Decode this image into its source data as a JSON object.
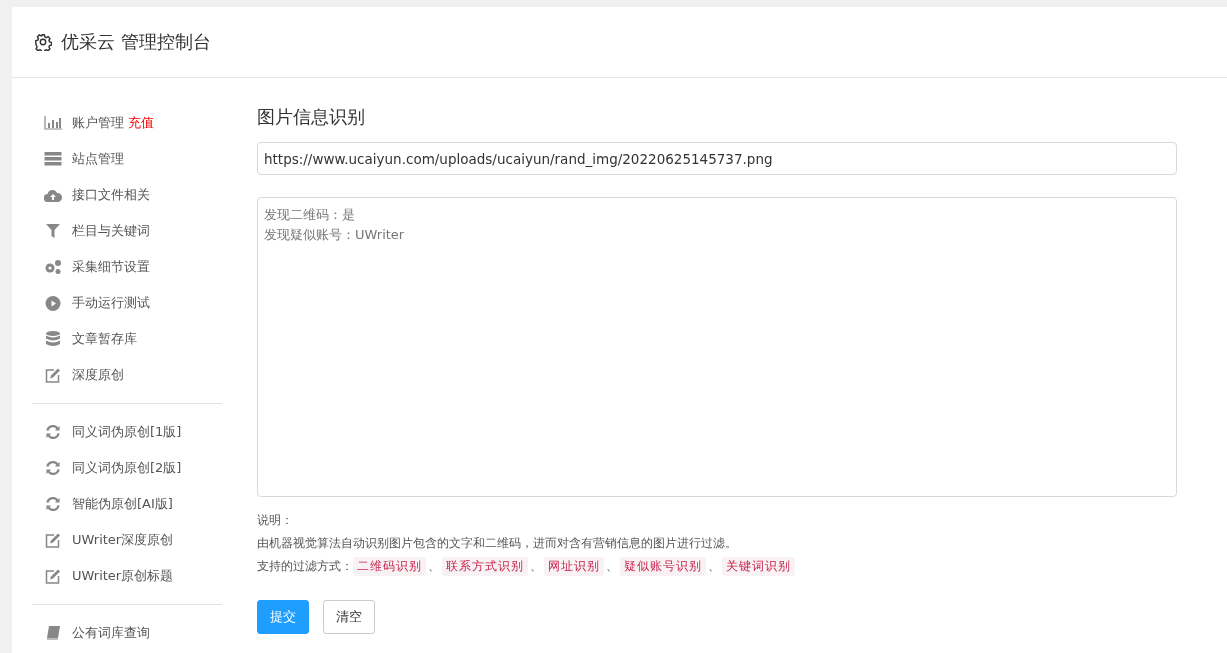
{
  "header": {
    "title": "优采云 管理控制台"
  },
  "sidebar": {
    "groups": [
      {
        "items": [
          {
            "kind": "chart",
            "label": "账户管理",
            "badge": "充值"
          },
          {
            "kind": "server",
            "label": "站点管理"
          },
          {
            "kind": "cloud",
            "label": "接口文件相关"
          },
          {
            "kind": "filter",
            "label": "栏目与关键词"
          },
          {
            "kind": "gears",
            "label": "采集细节设置"
          },
          {
            "kind": "play",
            "label": "手动运行测试"
          },
          {
            "kind": "database",
            "label": "文章暂存库"
          },
          {
            "kind": "edit",
            "label": "深度原创"
          }
        ]
      },
      {
        "items": [
          {
            "kind": "refresh",
            "label": "同义词伪原创[1版]"
          },
          {
            "kind": "refresh",
            "label": "同义词伪原创[2版]"
          },
          {
            "kind": "refresh",
            "label": "智能伪原创[AI版]"
          },
          {
            "kind": "edit",
            "label": "UWriter深度原创"
          },
          {
            "kind": "edit",
            "label": "UWriter原创标题"
          }
        ]
      },
      {
        "items": [
          {
            "kind": "book",
            "label": "公有词库查询"
          }
        ]
      }
    ]
  },
  "main": {
    "title": "图片信息识别",
    "url_field": {
      "value": "https://www.ucaiyun.com/uploads/ucaiyun/rand_img/20220625145737.png"
    },
    "result_box": {
      "lines": [
        "发现二维码：是",
        "发现疑似账号：UWriter"
      ]
    },
    "notes": {
      "heading": "说明：",
      "description": "由机器视觉算法自动识别图片包含的文字和二维码，进而对含有营销信息的图片进行过滤。",
      "methods_label": "支持的过滤方式：",
      "methods": [
        "二维码识别",
        "联系方式识别",
        "网址识别",
        "疑似账号识别",
        "关键词识别"
      ],
      "separator": "、"
    },
    "buttons": [
      {
        "kind": "primary",
        "label": "提交"
      },
      {
        "kind": "default",
        "label": "清空"
      }
    ]
  }
}
